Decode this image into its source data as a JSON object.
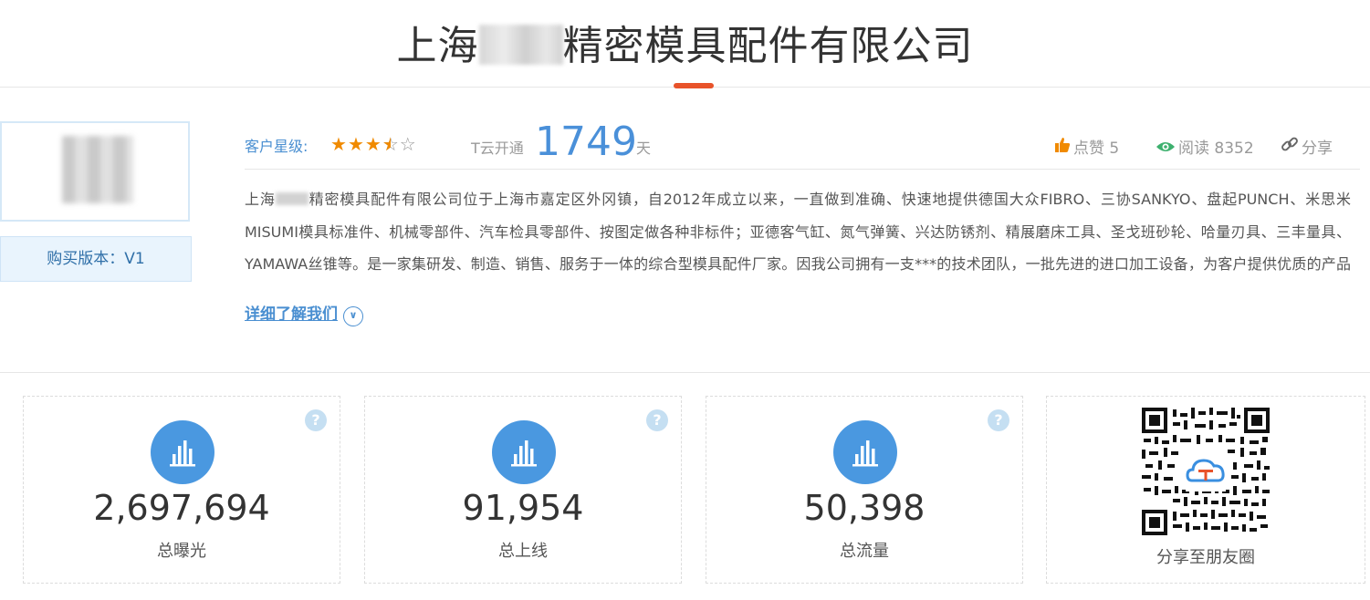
{
  "header": {
    "title_prefix": "上海",
    "title_suffix": "精密模具配件有限公司"
  },
  "profile": {
    "version_label": "购买版本：V1",
    "rating_label": "客户星级:",
    "rating_stars": 3.5,
    "rating_max": 5,
    "tyun_label": "T云开通",
    "tyun_days": "1749",
    "tyun_unit": "天",
    "like_label": "点赞 5",
    "read_label": "阅读 8352",
    "share_label": "分享"
  },
  "description": {
    "prefix": "上海",
    "text": "精密模具配件有限公司位于上海市嘉定区外冈镇，自2012年成立以来，一直做到准确、快速地提供德国大众FIBRO、三协SANKYO、盘起PUNCH、米思米MISUMI模具标准件、机械零部件、汽车检具零部件、按图定做各种非标件；亚德客气缸、氮气弹簧、兴达防锈剂、精展磨床工具、圣戈班砂轮、哈量刃具、三丰量具、YAMAWA丝锥等。是一家集研发、制造、销售、服务于一体的综合型模具配件厂家。因我公司拥有一支***的技术团队，一批先进的进口加工设备，为客户提供优质的产品和服务。",
    "more_label": "详细了解我们"
  },
  "stats": [
    {
      "value": "2,697,694",
      "label": "总曝光"
    },
    {
      "value": "91,954",
      "label": "总上线"
    },
    {
      "value": "50,398",
      "label": "总流量"
    }
  ],
  "qr": {
    "label": "分享至朋友圈"
  },
  "colors": {
    "accent": "#4a98e0",
    "title_underline": "#e8532a",
    "star": "#f08a00"
  }
}
